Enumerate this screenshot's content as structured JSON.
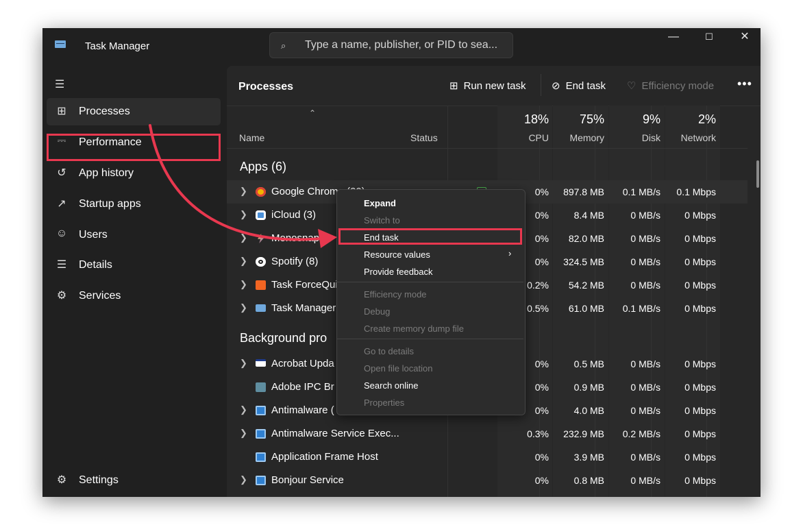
{
  "window": {
    "title": "Task Manager",
    "minimize": "—",
    "maximize": "☐",
    "close": "✕"
  },
  "search": {
    "icon": "search-icon",
    "placeholder": "Type a name, publisher, or PID to sea..."
  },
  "sidebar": {
    "items": [
      {
        "label": "Processes",
        "icon": "processes-icon"
      },
      {
        "label": "Performance",
        "icon": "performance-icon"
      },
      {
        "label": "App history",
        "icon": "app-history-icon"
      },
      {
        "label": "Startup apps",
        "icon": "startup-apps-icon"
      },
      {
        "label": "Users",
        "icon": "users-icon"
      },
      {
        "label": "Details",
        "icon": "details-icon"
      },
      {
        "label": "Services",
        "icon": "services-icon"
      }
    ],
    "settings_label": "Settings"
  },
  "toolbar": {
    "title": "Processes",
    "run_new_task": "Run new task",
    "end_task": "End task",
    "efficiency_mode": "Efficiency mode",
    "more": "•••"
  },
  "columns": {
    "name": "Name",
    "status": "Status",
    "cpu_pct": "18%",
    "cpu": "CPU",
    "mem_pct": "75%",
    "mem": "Memory",
    "disk_pct": "9%",
    "disk": "Disk",
    "net_pct": "2%",
    "net": "Network"
  },
  "groups": {
    "apps": "Apps (6)",
    "background": "Background pro"
  },
  "apps": [
    {
      "name": "Google Chrome (20)",
      "cpu": "0%",
      "mem": "897.8 MB",
      "disk": "0.1 MB/s",
      "net": "0.1 Mbps"
    },
    {
      "name": "iCloud (3)",
      "cpu": "0%",
      "mem": "8.4 MB",
      "disk": "0 MB/s",
      "net": "0 Mbps"
    },
    {
      "name": "Monosnap",
      "cpu": "0%",
      "mem": "82.0 MB",
      "disk": "0 MB/s",
      "net": "0 Mbps"
    },
    {
      "name": "Spotify (8)",
      "cpu": "0%",
      "mem": "324.5 MB",
      "disk": "0 MB/s",
      "net": "0 Mbps"
    },
    {
      "name": "Task ForceQui",
      "cpu": "0.2%",
      "mem": "54.2 MB",
      "disk": "0 MB/s",
      "net": "0 Mbps"
    },
    {
      "name": "Task Manager",
      "cpu": "0.5%",
      "mem": "61.0 MB",
      "disk": "0.1 MB/s",
      "net": "0 Mbps"
    }
  ],
  "background": [
    {
      "name": "Acrobat Upda",
      "cpu": "0%",
      "mem": "0.5 MB",
      "disk": "0 MB/s",
      "net": "0 Mbps"
    },
    {
      "name": "Adobe IPC Br",
      "cpu": "0%",
      "mem": "0.9 MB",
      "disk": "0 MB/s",
      "net": "0 Mbps"
    },
    {
      "name": "Antimalware (",
      "cpu": "0%",
      "mem": "4.0 MB",
      "disk": "0 MB/s",
      "net": "0 Mbps"
    },
    {
      "name": "Antimalware Service Exec...",
      "cpu": "0.3%",
      "mem": "232.9 MB",
      "disk": "0.2 MB/s",
      "net": "0 Mbps"
    },
    {
      "name": "Application Frame Host",
      "cpu": "0%",
      "mem": "3.9 MB",
      "disk": "0 MB/s",
      "net": "0 Mbps"
    },
    {
      "name": "Bonjour Service",
      "cpu": "0%",
      "mem": "0.8 MB",
      "disk": "0 MB/s",
      "net": "0 Mbps"
    }
  ],
  "context_menu": {
    "expand": "Expand",
    "switch_to": "Switch to",
    "end_task": "End task",
    "resource_values": "Resource values",
    "provide_feedback": "Provide feedback",
    "efficiency_mode": "Efficiency mode",
    "debug": "Debug",
    "create_dump": "Create memory dump file",
    "go_to_details": "Go to details",
    "open_file_location": "Open file location",
    "search_online": "Search online",
    "properties": "Properties"
  },
  "colors": {
    "highlight": "#e8384f",
    "background": "#202020",
    "panel": "#272727"
  }
}
